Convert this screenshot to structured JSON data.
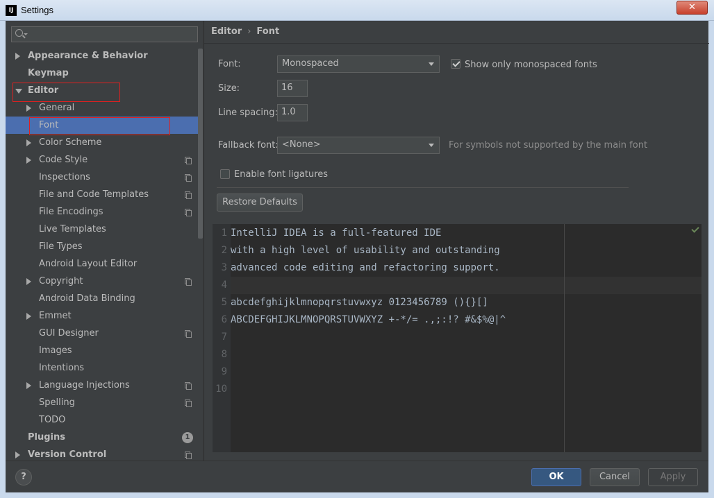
{
  "window": {
    "title": "Settings",
    "app_icon": "intellij-icon",
    "close_icon": "close-icon"
  },
  "search": {
    "placeholder": "",
    "icon": "search-icon"
  },
  "sidebar": {
    "items": [
      {
        "label": "Appearance & Behavior",
        "bold": true,
        "arrow": "right",
        "icon": null
      },
      {
        "label": "Keymap",
        "bold": true,
        "arrow": null,
        "icon": null
      },
      {
        "label": "Editor",
        "bold": true,
        "arrow": "down",
        "icon": null
      },
      {
        "label": "General",
        "bold": false,
        "arrow": "right",
        "icon": null
      },
      {
        "label": "Font",
        "bold": false,
        "arrow": null,
        "icon": null,
        "selected": true
      },
      {
        "label": "Color Scheme",
        "bold": false,
        "arrow": "right",
        "icon": null
      },
      {
        "label": "Code Style",
        "bold": false,
        "arrow": "right",
        "icon": "project-icon"
      },
      {
        "label": "Inspections",
        "bold": false,
        "arrow": null,
        "icon": "project-icon"
      },
      {
        "label": "File and Code Templates",
        "bold": false,
        "arrow": null,
        "icon": "project-icon"
      },
      {
        "label": "File Encodings",
        "bold": false,
        "arrow": null,
        "icon": "project-icon"
      },
      {
        "label": "Live Templates",
        "bold": false,
        "arrow": null,
        "icon": null
      },
      {
        "label": "File Types",
        "bold": false,
        "arrow": null,
        "icon": null
      },
      {
        "label": "Android Layout Editor",
        "bold": false,
        "arrow": null,
        "icon": null
      },
      {
        "label": "Copyright",
        "bold": false,
        "arrow": "right",
        "icon": "project-icon"
      },
      {
        "label": "Android Data Binding",
        "bold": false,
        "arrow": null,
        "icon": null
      },
      {
        "label": "Emmet",
        "bold": false,
        "arrow": "right",
        "icon": null
      },
      {
        "label": "GUI Designer",
        "bold": false,
        "arrow": null,
        "icon": "project-icon"
      },
      {
        "label": "Images",
        "bold": false,
        "arrow": null,
        "icon": null
      },
      {
        "label": "Intentions",
        "bold": false,
        "arrow": null,
        "icon": null
      },
      {
        "label": "Language Injections",
        "bold": false,
        "arrow": "right",
        "icon": "project-icon"
      },
      {
        "label": "Spelling",
        "bold": false,
        "arrow": null,
        "icon": "project-icon"
      },
      {
        "label": "TODO",
        "bold": false,
        "arrow": null,
        "icon": null
      },
      {
        "label": "Plugins",
        "bold": true,
        "arrow": null,
        "badge": "1"
      },
      {
        "label": "Version Control",
        "bold": true,
        "arrow": "right",
        "icon": "project-icon"
      }
    ]
  },
  "breadcrumb": {
    "parent": "Editor",
    "separator": "›",
    "current": "Font"
  },
  "font_settings": {
    "font_label": "Font:",
    "font_value": "Monospaced",
    "show_mono_label": "Show only monospaced fonts",
    "show_mono_checked": true,
    "size_label": "Size:",
    "size_value": "16",
    "line_spacing_label": "Line spacing:",
    "line_spacing_value": "1.0",
    "fallback_label": "Fallback font:",
    "fallback_value": "<None>",
    "fallback_hint": "For symbols not supported by the main font",
    "ligatures_label": "Enable font ligatures",
    "ligatures_checked": false,
    "restore_label": "Restore Defaults"
  },
  "preview": {
    "line_numbers": [
      "1",
      "2",
      "3",
      "4",
      "5",
      "6",
      "7",
      "8",
      "9",
      "10"
    ],
    "lines": [
      "IntelliJ IDEA is a full-featured IDE",
      "with a high level of usability and outstanding",
      "advanced code editing and refactoring support.",
      "",
      "abcdefghijklmnopqrstuvwxyz 0123456789 (){}[]",
      "ABCDEFGHIJKLMNOPQRSTUVWXYZ +-*/= .,;:!? #&$%@|^",
      "",
      "",
      "",
      ""
    ]
  },
  "footer": {
    "help_label": "?",
    "ok_label": "OK",
    "cancel_label": "Cancel",
    "apply_label": "Apply"
  },
  "colors": {
    "accent": "#4b6eaf",
    "background": "#3c3f41",
    "editor_bg": "#2b2b2b",
    "highlight": "#e02020"
  }
}
